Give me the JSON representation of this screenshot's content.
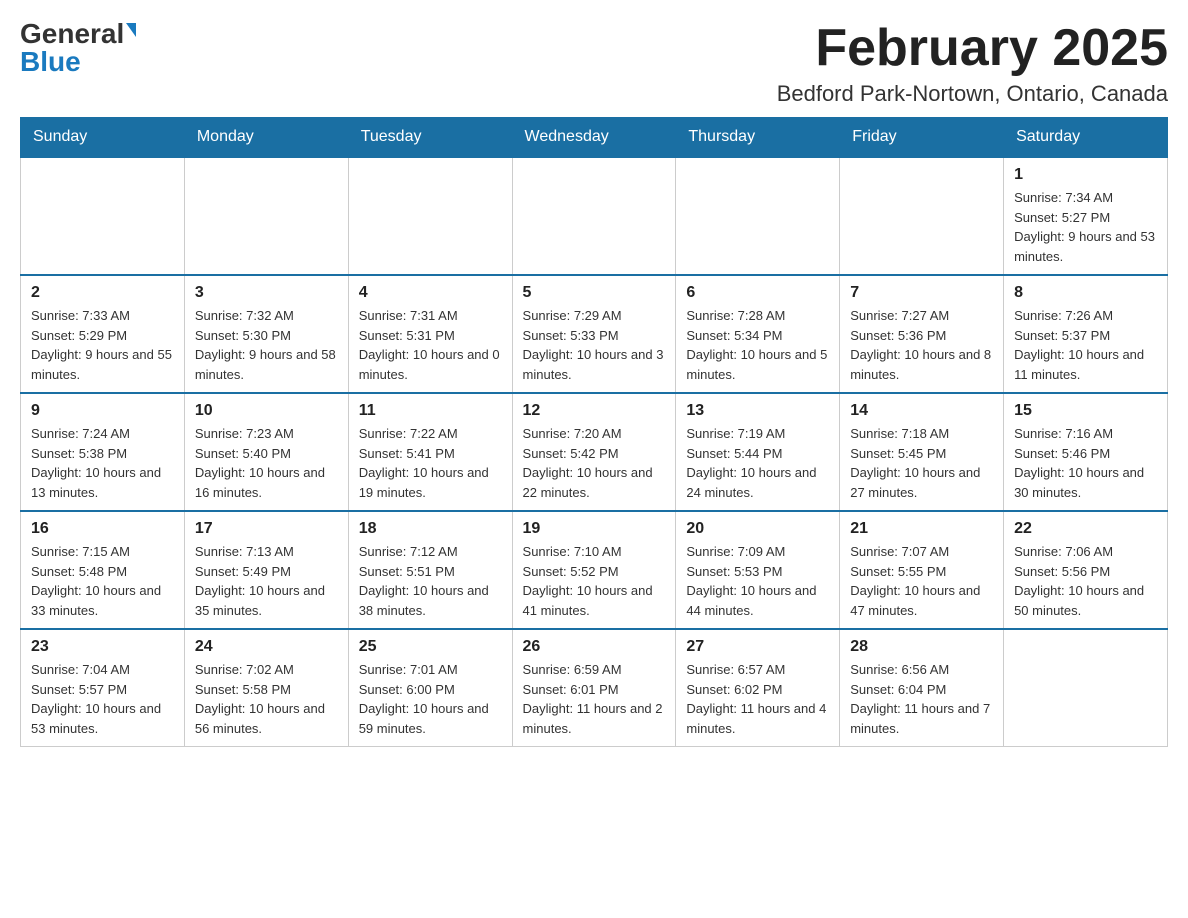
{
  "header": {
    "logo_general": "General",
    "logo_blue": "Blue",
    "month_title": "February 2025",
    "location": "Bedford Park-Nortown, Ontario, Canada"
  },
  "weekdays": [
    "Sunday",
    "Monday",
    "Tuesday",
    "Wednesday",
    "Thursday",
    "Friday",
    "Saturday"
  ],
  "weeks": [
    [
      {
        "day": "",
        "info": ""
      },
      {
        "day": "",
        "info": ""
      },
      {
        "day": "",
        "info": ""
      },
      {
        "day": "",
        "info": ""
      },
      {
        "day": "",
        "info": ""
      },
      {
        "day": "",
        "info": ""
      },
      {
        "day": "1",
        "info": "Sunrise: 7:34 AM\nSunset: 5:27 PM\nDaylight: 9 hours and 53 minutes."
      }
    ],
    [
      {
        "day": "2",
        "info": "Sunrise: 7:33 AM\nSunset: 5:29 PM\nDaylight: 9 hours and 55 minutes."
      },
      {
        "day": "3",
        "info": "Sunrise: 7:32 AM\nSunset: 5:30 PM\nDaylight: 9 hours and 58 minutes."
      },
      {
        "day": "4",
        "info": "Sunrise: 7:31 AM\nSunset: 5:31 PM\nDaylight: 10 hours and 0 minutes."
      },
      {
        "day": "5",
        "info": "Sunrise: 7:29 AM\nSunset: 5:33 PM\nDaylight: 10 hours and 3 minutes."
      },
      {
        "day": "6",
        "info": "Sunrise: 7:28 AM\nSunset: 5:34 PM\nDaylight: 10 hours and 5 minutes."
      },
      {
        "day": "7",
        "info": "Sunrise: 7:27 AM\nSunset: 5:36 PM\nDaylight: 10 hours and 8 minutes."
      },
      {
        "day": "8",
        "info": "Sunrise: 7:26 AM\nSunset: 5:37 PM\nDaylight: 10 hours and 11 minutes."
      }
    ],
    [
      {
        "day": "9",
        "info": "Sunrise: 7:24 AM\nSunset: 5:38 PM\nDaylight: 10 hours and 13 minutes."
      },
      {
        "day": "10",
        "info": "Sunrise: 7:23 AM\nSunset: 5:40 PM\nDaylight: 10 hours and 16 minutes."
      },
      {
        "day": "11",
        "info": "Sunrise: 7:22 AM\nSunset: 5:41 PM\nDaylight: 10 hours and 19 minutes."
      },
      {
        "day": "12",
        "info": "Sunrise: 7:20 AM\nSunset: 5:42 PM\nDaylight: 10 hours and 22 minutes."
      },
      {
        "day": "13",
        "info": "Sunrise: 7:19 AM\nSunset: 5:44 PM\nDaylight: 10 hours and 24 minutes."
      },
      {
        "day": "14",
        "info": "Sunrise: 7:18 AM\nSunset: 5:45 PM\nDaylight: 10 hours and 27 minutes."
      },
      {
        "day": "15",
        "info": "Sunrise: 7:16 AM\nSunset: 5:46 PM\nDaylight: 10 hours and 30 minutes."
      }
    ],
    [
      {
        "day": "16",
        "info": "Sunrise: 7:15 AM\nSunset: 5:48 PM\nDaylight: 10 hours and 33 minutes."
      },
      {
        "day": "17",
        "info": "Sunrise: 7:13 AM\nSunset: 5:49 PM\nDaylight: 10 hours and 35 minutes."
      },
      {
        "day": "18",
        "info": "Sunrise: 7:12 AM\nSunset: 5:51 PM\nDaylight: 10 hours and 38 minutes."
      },
      {
        "day": "19",
        "info": "Sunrise: 7:10 AM\nSunset: 5:52 PM\nDaylight: 10 hours and 41 minutes."
      },
      {
        "day": "20",
        "info": "Sunrise: 7:09 AM\nSunset: 5:53 PM\nDaylight: 10 hours and 44 minutes."
      },
      {
        "day": "21",
        "info": "Sunrise: 7:07 AM\nSunset: 5:55 PM\nDaylight: 10 hours and 47 minutes."
      },
      {
        "day": "22",
        "info": "Sunrise: 7:06 AM\nSunset: 5:56 PM\nDaylight: 10 hours and 50 minutes."
      }
    ],
    [
      {
        "day": "23",
        "info": "Sunrise: 7:04 AM\nSunset: 5:57 PM\nDaylight: 10 hours and 53 minutes."
      },
      {
        "day": "24",
        "info": "Sunrise: 7:02 AM\nSunset: 5:58 PM\nDaylight: 10 hours and 56 minutes."
      },
      {
        "day": "25",
        "info": "Sunrise: 7:01 AM\nSunset: 6:00 PM\nDaylight: 10 hours and 59 minutes."
      },
      {
        "day": "26",
        "info": "Sunrise: 6:59 AM\nSunset: 6:01 PM\nDaylight: 11 hours and 2 minutes."
      },
      {
        "day": "27",
        "info": "Sunrise: 6:57 AM\nSunset: 6:02 PM\nDaylight: 11 hours and 4 minutes."
      },
      {
        "day": "28",
        "info": "Sunrise: 6:56 AM\nSunset: 6:04 PM\nDaylight: 11 hours and 7 minutes."
      },
      {
        "day": "",
        "info": ""
      }
    ]
  ]
}
